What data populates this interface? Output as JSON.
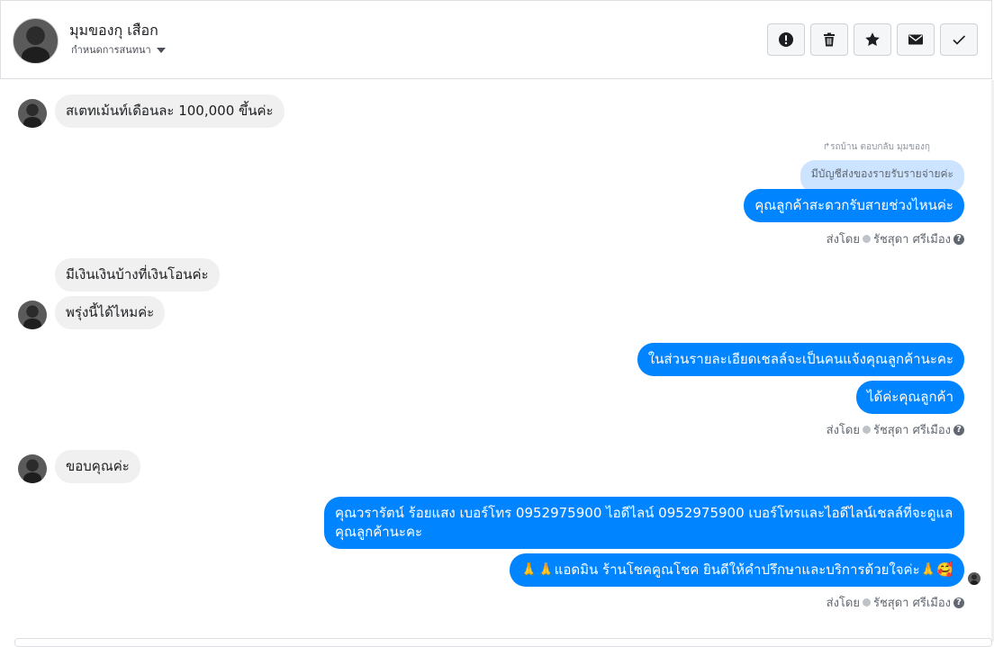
{
  "header": {
    "name": "มุมของกุ เสือก",
    "subtitle": "กำหนดการสนทนา",
    "actions": [
      {
        "name": "mark-spam-button",
        "icon": "exclamation-icon"
      },
      {
        "name": "delete-button",
        "icon": "trash-icon"
      },
      {
        "name": "star-button",
        "icon": "star-icon"
      },
      {
        "name": "mark-unread-button",
        "icon": "envelope-icon"
      },
      {
        "name": "mark-done-button",
        "icon": "checkmark-icon"
      }
    ]
  },
  "messages": {
    "m1": "สเตทเม้นท์เดือนละ 100,000 ขึ้นค่ะ",
    "reply_note": "↱รถบ้าน ตอบกลับ มุมของกุ",
    "reply_quote": "มีบัญชีส่งของรายรับรายจ่ายค่ะ",
    "m2": "คุณลูกค้าสะดวกรับสายช่วงไหนค่ะ",
    "m3": "มีเงินเงินบ้างที่เงินโอนค่ะ",
    "m4": "พรุ่งนี้ได้ไหมค่ะ",
    "m5": "ในส่วนรายละเอียดเชลล์จะเป็นคนแจ้งคุณลูกค้านะคะ",
    "m6": "ได้ค่ะคุณลูกค้า",
    "m7": "ขอบคุณค่ะ",
    "m8": "คุณวรารัตน์ ร้อยแสง        เบอร์โทร 0952975900  ไอดีไลน์ 0952975900   เบอร์โทรและไอดีไลน์เชลล์ที่จะดูแลคุณลูกค้านะคะ",
    "m9": "🙏🙏แอดมิน ร้านโชคคูณโชค ยินดีให้คำปรึกษาและบริการด้วยใจค่ะ🙏🥰"
  },
  "sent_by": {
    "prefix": "ส่งโดย",
    "agent": "รัชสุดา ศรีเมือง",
    "help": "?"
  },
  "colors": {
    "outgoing": "#0084ff",
    "incoming": "#f0f0f0",
    "quote": "#cce4ff"
  }
}
